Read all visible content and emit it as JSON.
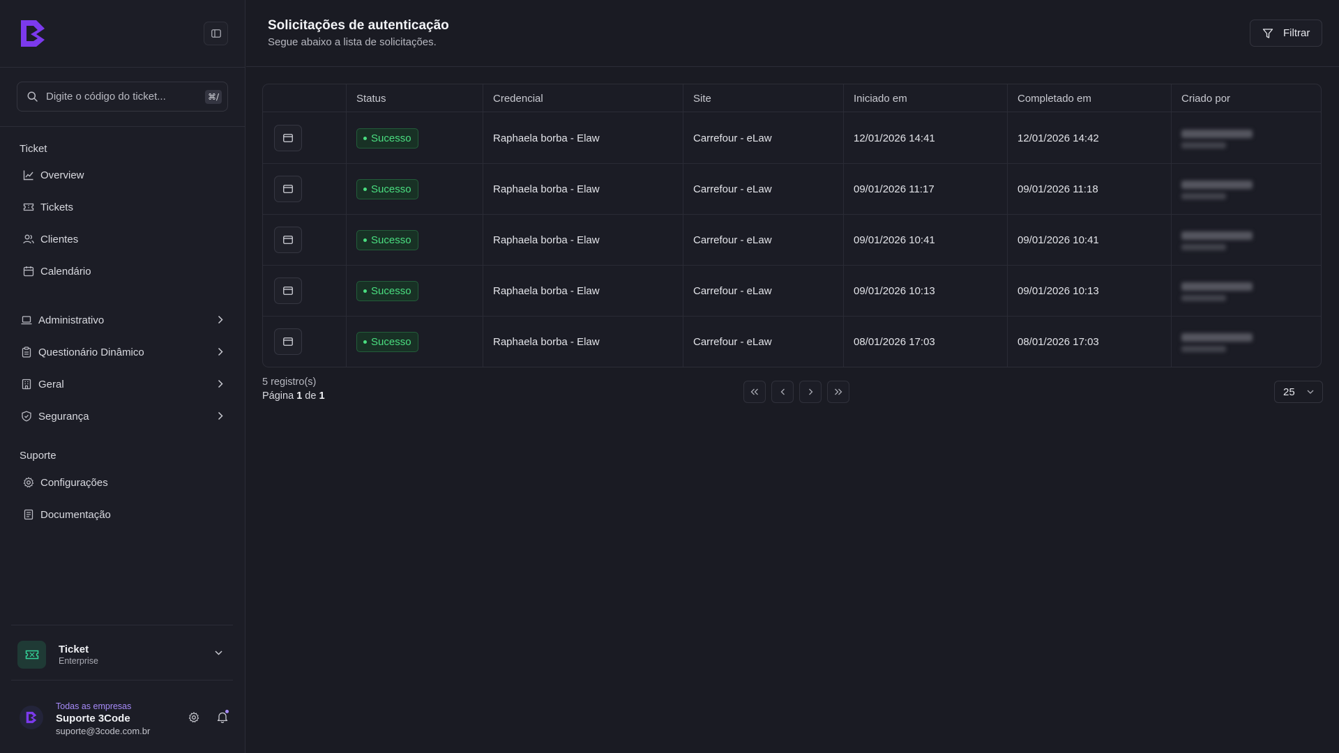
{
  "sidebar": {
    "search": {
      "placeholder": "Digite o código do ticket...",
      "shortcut": "⌘/"
    },
    "section_ticket": "Ticket",
    "ticket_items": [
      {
        "label": "Overview",
        "icon": "chart-line-icon"
      },
      {
        "label": "Tickets",
        "icon": "ticket-icon"
      },
      {
        "label": "Clientes",
        "icon": "users-icon"
      },
      {
        "label": "Calendário",
        "icon": "calendar-icon"
      }
    ],
    "group_items": [
      {
        "label": "Administrativo",
        "icon": "laptop-icon"
      },
      {
        "label": "Questionário Dinâmico",
        "icon": "clipboard-icon"
      },
      {
        "label": "Geral",
        "icon": "building-icon"
      },
      {
        "label": "Segurança",
        "icon": "shield-icon"
      }
    ],
    "section_support": "Suporte",
    "support_items": [
      {
        "label": "Configurações",
        "icon": "gear-icon"
      },
      {
        "label": "Documentação",
        "icon": "document-icon"
      }
    ],
    "plan": {
      "title": "Ticket",
      "subtitle": "Enterprise"
    },
    "user": {
      "company": "Todas as empresas",
      "name": "Suporte 3Code",
      "email": "suporte@3code.com.br"
    }
  },
  "header": {
    "title": "Solicitações de autenticação",
    "subtitle": "Segue abaixo a lista de solicitações.",
    "filter_label": "Filtrar"
  },
  "table": {
    "columns": [
      "",
      "Status",
      "Credencial",
      "Site",
      "Iniciado em",
      "Completado em",
      "Criado por"
    ],
    "rows": [
      {
        "status": "Sucesso",
        "credential": "Raphaela borba - Elaw",
        "site": "Carrefour - eLaw",
        "started": "12/01/2026 14:41",
        "completed": "12/01/2026 14:42"
      },
      {
        "status": "Sucesso",
        "credential": "Raphaela borba - Elaw",
        "site": "Carrefour - eLaw",
        "started": "09/01/2026 11:17",
        "completed": "09/01/2026 11:18"
      },
      {
        "status": "Sucesso",
        "credential": "Raphaela borba - Elaw",
        "site": "Carrefour - eLaw",
        "started": "09/01/2026 10:41",
        "completed": "09/01/2026 10:41"
      },
      {
        "status": "Sucesso",
        "credential": "Raphaela borba - Elaw",
        "site": "Carrefour - eLaw",
        "started": "09/01/2026 10:13",
        "completed": "09/01/2026 10:13"
      },
      {
        "status": "Sucesso",
        "credential": "Raphaela borba - Elaw",
        "site": "Carrefour - eLaw",
        "started": "08/01/2026 17:03",
        "completed": "08/01/2026 17:03"
      }
    ]
  },
  "pagination": {
    "records": "5 registro(s)",
    "page_prefix": "Página",
    "page_current": "1",
    "page_sep": "de",
    "page_total": "1",
    "per_page": "25"
  },
  "colors": {
    "accent": "#7c3aed",
    "success": "#4ade80",
    "background": "#1a1b23"
  }
}
